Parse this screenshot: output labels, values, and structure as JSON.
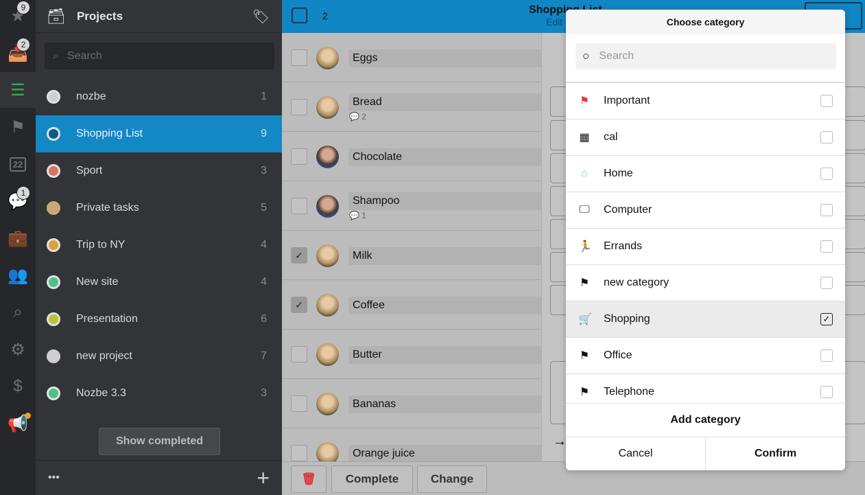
{
  "rail": {
    "items": [
      {
        "icon": "star-icon",
        "badge": "9"
      },
      {
        "icon": "inbox-icon",
        "badge": "2"
      },
      {
        "icon": "projects-icon",
        "active": true
      },
      {
        "icon": "flag-icon"
      },
      {
        "icon": "calendar-icon",
        "label": "22"
      },
      {
        "icon": "comments-icon",
        "badge": "1"
      },
      {
        "icon": "briefcase-icon"
      },
      {
        "icon": "team-icon"
      },
      {
        "icon": "search-icon"
      },
      {
        "icon": "settings-icon"
      },
      {
        "icon": "billing-icon"
      },
      {
        "icon": "announcements-icon"
      }
    ]
  },
  "sidebar": {
    "title": "Projects",
    "search_placeholder": "Search",
    "show_completed": "Show completed",
    "more": "•••",
    "add": "+",
    "projects": [
      {
        "name": "nozbe",
        "count": "1",
        "color": "#cfcfcf",
        "ring": true
      },
      {
        "name": "Shopping List",
        "count": "9",
        "color": "#0b5b88",
        "ring": true,
        "selected": true
      },
      {
        "name": "Sport",
        "count": "3",
        "color": "#d9735f",
        "ring": true
      },
      {
        "name": "Private tasks",
        "count": "5",
        "color": "#c9a978",
        "ring": false
      },
      {
        "name": "Trip to NY",
        "count": "4",
        "color": "#d9a23a",
        "ring": true
      },
      {
        "name": "New site",
        "count": "4",
        "color": "#4fc08a",
        "ring": true
      },
      {
        "name": "Presentation",
        "count": "6",
        "color": "#b8c23a",
        "ring": true
      },
      {
        "name": "new project",
        "count": "7",
        "color": "#cfcfcf",
        "ring": false
      },
      {
        "name": "Nozbe 3.3",
        "count": "3",
        "color": "#4fc08a",
        "ring": true
      }
    ]
  },
  "header": {
    "selected_count": "2",
    "title": "Shopping List",
    "subtitle": "Edit"
  },
  "tasks": [
    {
      "name": "Eggs",
      "checked": false,
      "avatar": "f"
    },
    {
      "name": "Bread",
      "checked": false,
      "avatar": "f",
      "comments": "2"
    },
    {
      "name": "Chocolate",
      "checked": false,
      "avatar": "m"
    },
    {
      "name": "Shampoo",
      "checked": false,
      "avatar": "m",
      "comments": "1"
    },
    {
      "name": "Milk",
      "checked": true,
      "avatar": "f"
    },
    {
      "name": "Coffee",
      "checked": true,
      "avatar": "f"
    },
    {
      "name": "Butter",
      "checked": false,
      "avatar": "f"
    },
    {
      "name": "Bananas",
      "checked": false,
      "avatar": "f"
    },
    {
      "name": "Orange juice",
      "checked": false,
      "avatar": "f"
    }
  ],
  "toolbar": {
    "complete": "Complete",
    "change": "Change"
  },
  "modal": {
    "title": "Choose category",
    "search_placeholder": "Search",
    "add_category": "Add category",
    "cancel": "Cancel",
    "confirm": "Confirm",
    "categories": [
      {
        "name": "Important",
        "icon": "flag-icon",
        "color": "#e8383d",
        "checked": false
      },
      {
        "name": "cal",
        "icon": "calendar-icon",
        "color": "#111111",
        "checked": false
      },
      {
        "name": "Home",
        "icon": "home-icon",
        "color": "#5bc8e8",
        "checked": false
      },
      {
        "name": "Computer",
        "icon": "computer-icon",
        "color": "#111111",
        "checked": false
      },
      {
        "name": "Errands",
        "icon": "running-icon",
        "color": "#f08a6a",
        "checked": false
      },
      {
        "name": "new category",
        "icon": "flag-icon",
        "color": "#111111",
        "checked": false
      },
      {
        "name": "Shopping",
        "icon": "cart-icon",
        "color": "#111111",
        "checked": true
      },
      {
        "name": "Office",
        "icon": "flag-icon",
        "color": "#111111",
        "checked": false
      },
      {
        "name": "Telephone",
        "icon": "flag-icon",
        "color": "#111111",
        "checked": false
      }
    ]
  }
}
